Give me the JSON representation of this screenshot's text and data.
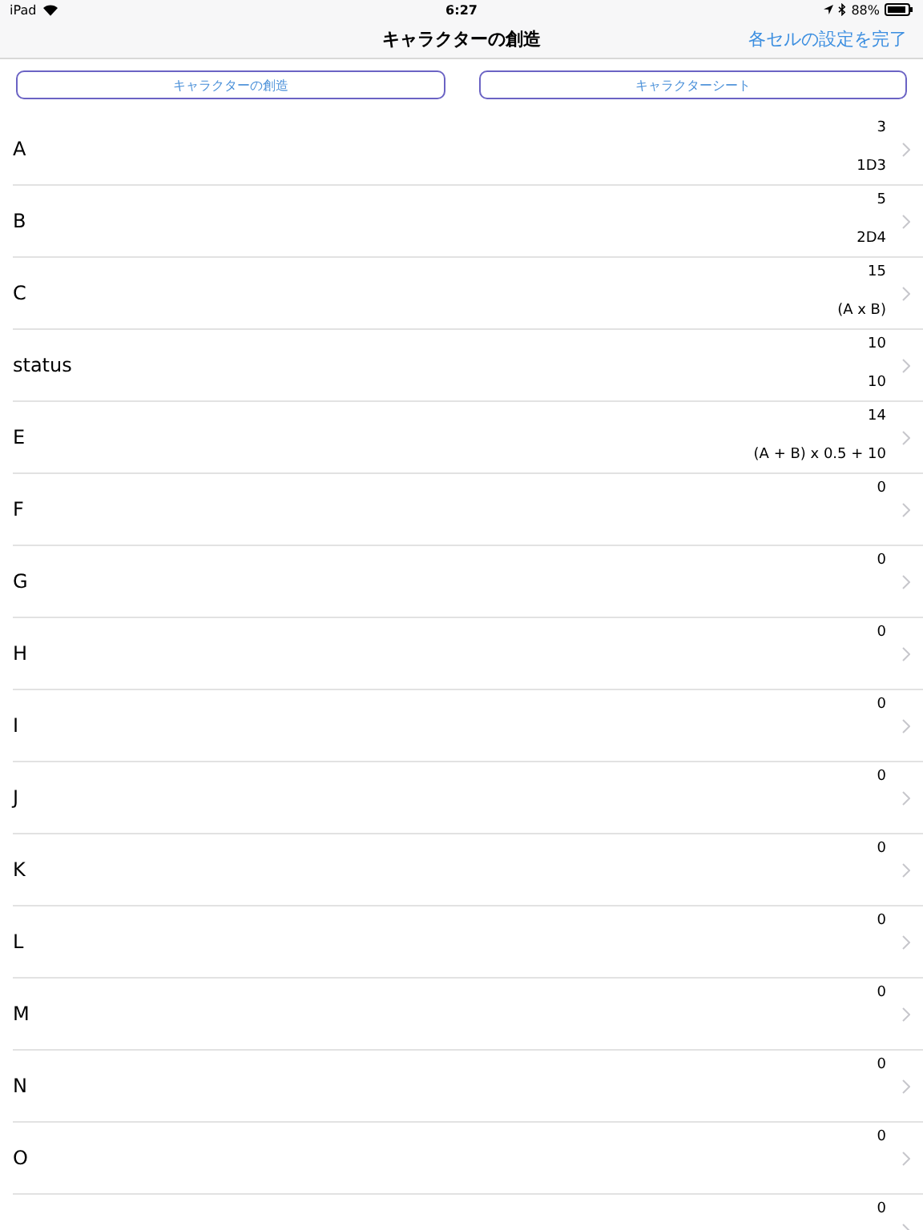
{
  "status_bar": {
    "device": "iPad",
    "time": "6:27",
    "battery": "88%"
  },
  "nav": {
    "title": "キャラクターの創造",
    "action": "各セルの設定を完了"
  },
  "segments": [
    {
      "label": "キャラクターの創造"
    },
    {
      "label": "キャラクターシート"
    }
  ],
  "rows": [
    {
      "label": "A",
      "value": "3",
      "detail": "1D3"
    },
    {
      "label": "B",
      "value": "5",
      "detail": "2D4"
    },
    {
      "label": "C",
      "value": "15",
      "detail": "(A x B)"
    },
    {
      "label": "status",
      "value": "10",
      "detail": "10"
    },
    {
      "label": "E",
      "value": "14",
      "detail": "(A + B) x 0.5 + 10"
    },
    {
      "label": "F",
      "value": "0"
    },
    {
      "label": "G",
      "value": "0"
    },
    {
      "label": "H",
      "value": "0"
    },
    {
      "label": "I",
      "value": "0"
    },
    {
      "label": "J",
      "value": "0"
    },
    {
      "label": "K",
      "value": "0"
    },
    {
      "label": "L",
      "value": "0"
    },
    {
      "label": "M",
      "value": "0"
    },
    {
      "label": "N",
      "value": "0"
    },
    {
      "label": "O",
      "value": "0"
    },
    {
      "value": "0"
    }
  ]
}
